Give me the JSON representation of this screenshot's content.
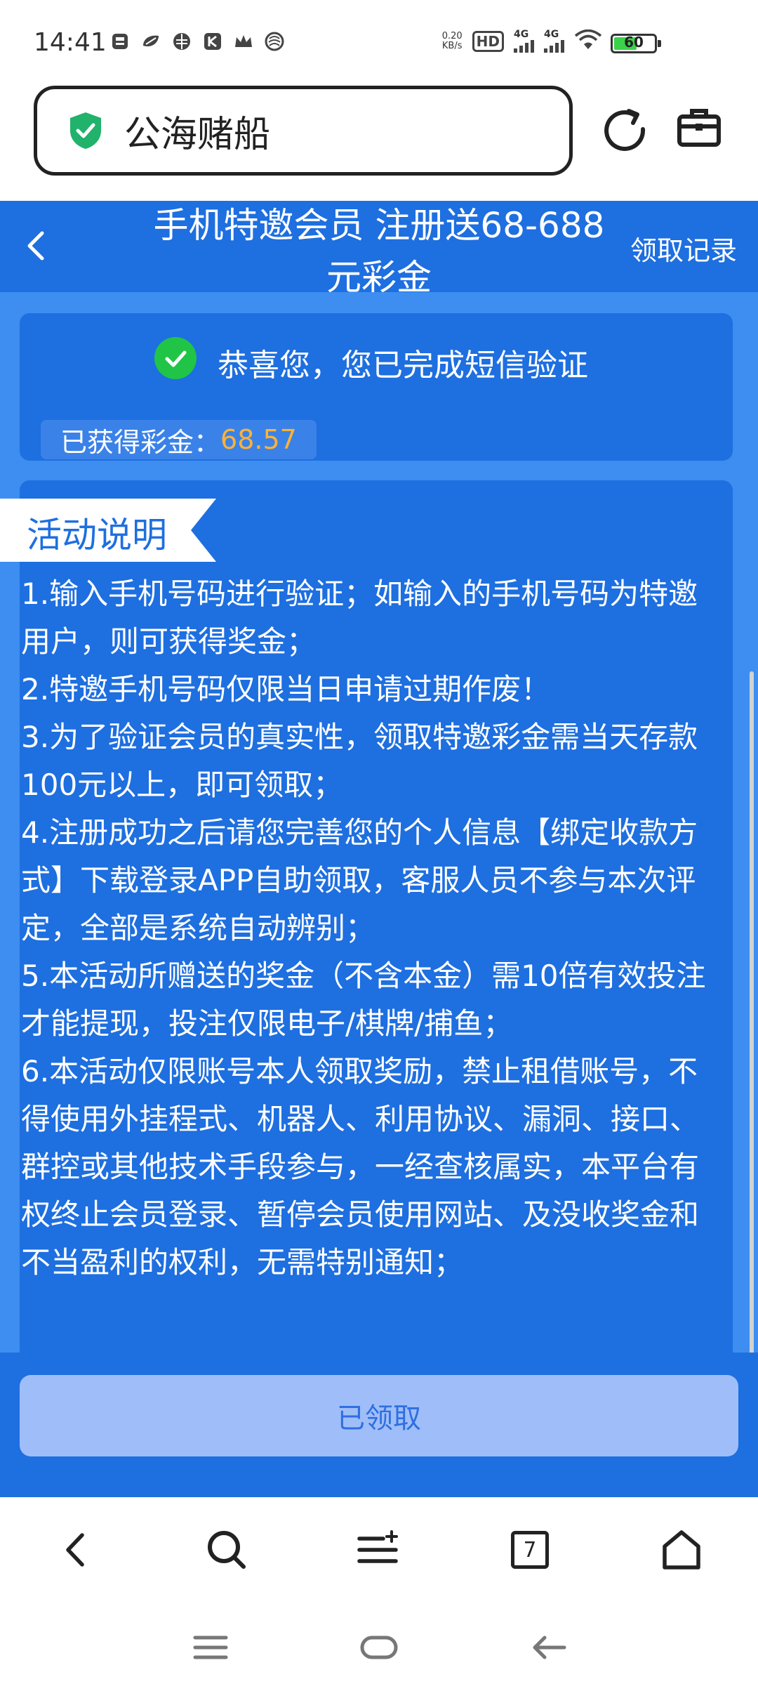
{
  "status_bar": {
    "time": "14:41",
    "net_speed_value": "0.20",
    "net_speed_unit": "KB/s",
    "hd_label": "HD",
    "signal1_label": "4G",
    "signal2_label": "4G",
    "battery_level": "60",
    "battery_fraction": 0.6,
    "battery_fill_color": "#3bd24a"
  },
  "browser": {
    "url_text": "公海赌船",
    "icons": [
      "shield-check-icon",
      "reload-icon",
      "toolbox-icon"
    ]
  },
  "header": {
    "title": "手机特邀会员 注册送68-688元彩金",
    "records_link": "领取记录"
  },
  "verify": {
    "message": "恭喜您，您已完成短信验证",
    "bonus_label": "已获得彩金：",
    "bonus_value": "68.57"
  },
  "rules": {
    "heading": "活动说明",
    "items": [
      "1.输入手机号码进行验证；如输入的手机号码为特邀用户，则可获得奖金；",
      "2.特邀手机号码仅限当日申请过期作废！",
      "3.为了验证会员的真实性，领取特邀彩金需当天存款100元以上，即可领取；",
      "4.注册成功之后请您完善您的个人信息【绑定收款方式】下载登录APP自助领取，客服人员不参与本次评定，全部是系统自动辨别；",
      "5.本活动所赠送的奖金（不含本金）需10倍有效投注才能提现，投注仅限电子/棋牌/捕鱼；",
      "6.本活动仅限账号本人领取奖励，禁止租借账号，不得使用外挂程式、机器人、利用协议、漏洞、接口、群控或其他技术手段参与，一经查核属实，本平台有权终止会员登录、暂停会员使用网站、及没收奖金和不当盈利的权利，无需特别通知；"
    ]
  },
  "claim_button": "已领取",
  "bottom_nav": {
    "tabs_count": "7",
    "icons": [
      "back-icon",
      "search-icon",
      "menu-icon",
      "tabs-icon",
      "home-icon"
    ]
  },
  "colors": {
    "primary_blue": "#1e6fe0",
    "light_blue": "#3d8ef0",
    "check_green": "#20c548",
    "bonus_orange": "#ffb236",
    "claimed_button": "#9fbef9"
  }
}
